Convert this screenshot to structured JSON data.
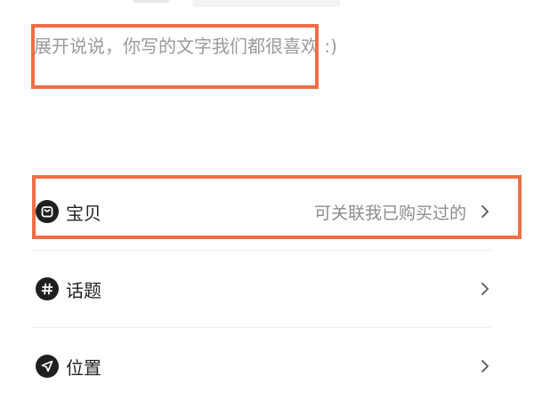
{
  "editor": {
    "placeholder": "展开说说，你写的文字我们都很喜欢 :)",
    "value": ""
  },
  "options": {
    "goods": {
      "label": "宝贝",
      "hint": "可关联我已购买过的",
      "icon": "shopping-bag-icon"
    },
    "topic": {
      "label": "话题",
      "icon": "hashtag-icon"
    },
    "location": {
      "label": "位置",
      "icon": "location-arrow-icon"
    }
  },
  "colors": {
    "highlight": "#ef6e45",
    "icon_background": "#1f1f1f",
    "placeholder_text": "#9a9a9a",
    "hint_text": "#8c8c8c"
  }
}
